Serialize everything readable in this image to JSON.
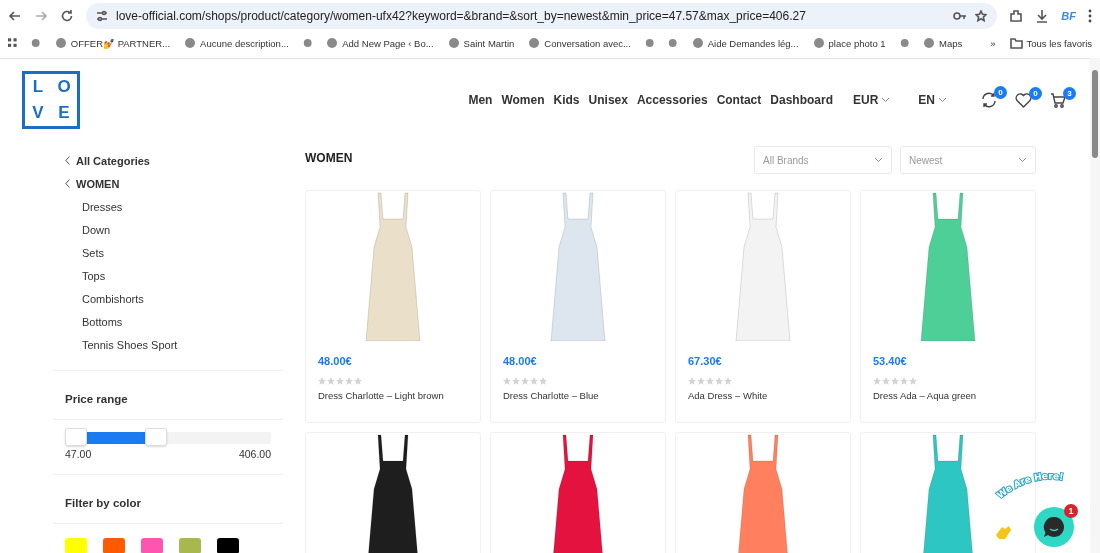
{
  "browser": {
    "url": "love-official.com/shops/product/category/women-ufx42?keyword=&brand=&sort_by=newest&min_price=47.57&max_price=406.27",
    "profile": "BF",
    "bookmarks": [
      {
        "kind": "icon"
      },
      {
        "kind": "link",
        "label": "OFFER💅 PARTNER..."
      },
      {
        "kind": "link",
        "label": "Aucune description..."
      },
      {
        "kind": "icon"
      },
      {
        "kind": "link",
        "label": "Add New Page ‹ Bo..."
      },
      {
        "kind": "link",
        "label": "Saint Martin"
      },
      {
        "kind": "link",
        "label": "Conversation avec..."
      },
      {
        "kind": "icon"
      },
      {
        "kind": "icon"
      },
      {
        "kind": "link",
        "label": "Aide Demandes lég..."
      },
      {
        "kind": "link",
        "label": "place photo 1"
      },
      {
        "kind": "icon"
      },
      {
        "kind": "link",
        "label": "Maps"
      }
    ],
    "more": "»",
    "all_bookmarks": "Tous les favoris"
  },
  "header": {
    "logo_letters": [
      "L",
      "O",
      "V",
      "E"
    ],
    "nav": [
      "Men",
      "Women",
      "Kids",
      "Unisex",
      "Accessories",
      "Contact",
      "Dashboard"
    ],
    "currency": "EUR",
    "language": "EN",
    "icons": [
      {
        "kind": "compare",
        "badge": "0"
      },
      {
        "kind": "wishlist",
        "badge": "0"
      },
      {
        "kind": "cart",
        "badge": "3"
      }
    ]
  },
  "sidebar": {
    "back_links": [
      "All Categories",
      "WOMEN"
    ],
    "categories": [
      "Dresses",
      "Down",
      "Sets",
      "Tops",
      "Combishorts",
      "Bottoms",
      "Tennis Shoes Sport"
    ],
    "price_range": {
      "title": "Price range",
      "min_thumb": {
        "level": 0
      },
      "max_thumb": {
        "level": 0.44
      },
      "min_label": "47.00",
      "max_label": "406.00"
    },
    "color_filter": {
      "title": "Filter by color",
      "swatches": [
        {
          "color": "#ffff00"
        },
        {
          "color": "#ff5a00"
        },
        {
          "color": "#ff55b0"
        },
        {
          "color": "#a8b84c"
        },
        {
          "color": "#000000"
        }
      ]
    }
  },
  "main": {
    "title": "WOMEN",
    "filters": [
      {
        "value": "All Brands"
      },
      {
        "value": "Newest"
      }
    ],
    "products": [
      {
        "color": "#eadfc8",
        "price": "48.00€",
        "stars": 0,
        "name": "Dress Charlotte – Light brown"
      },
      {
        "color": "#dde6ee",
        "price": "48.00€",
        "stars": 0,
        "name": "Dress Charlotte – Blue"
      },
      {
        "color": "#f3f3f3",
        "price": "67.30€",
        "stars": 0,
        "name": "Ada Dress – White"
      },
      {
        "color": "#4fcf98",
        "price": "53.40€",
        "stars": 0,
        "name": "Dress Ada – Aqua green"
      },
      {
        "color": "#1e1e1e"
      },
      {
        "color": "#e3123f"
      },
      {
        "color": "#ff7f5e"
      },
      {
        "color": "#2ec6c2"
      }
    ]
  },
  "chat": {
    "caption": "We Are Here!",
    "badge": "1"
  }
}
